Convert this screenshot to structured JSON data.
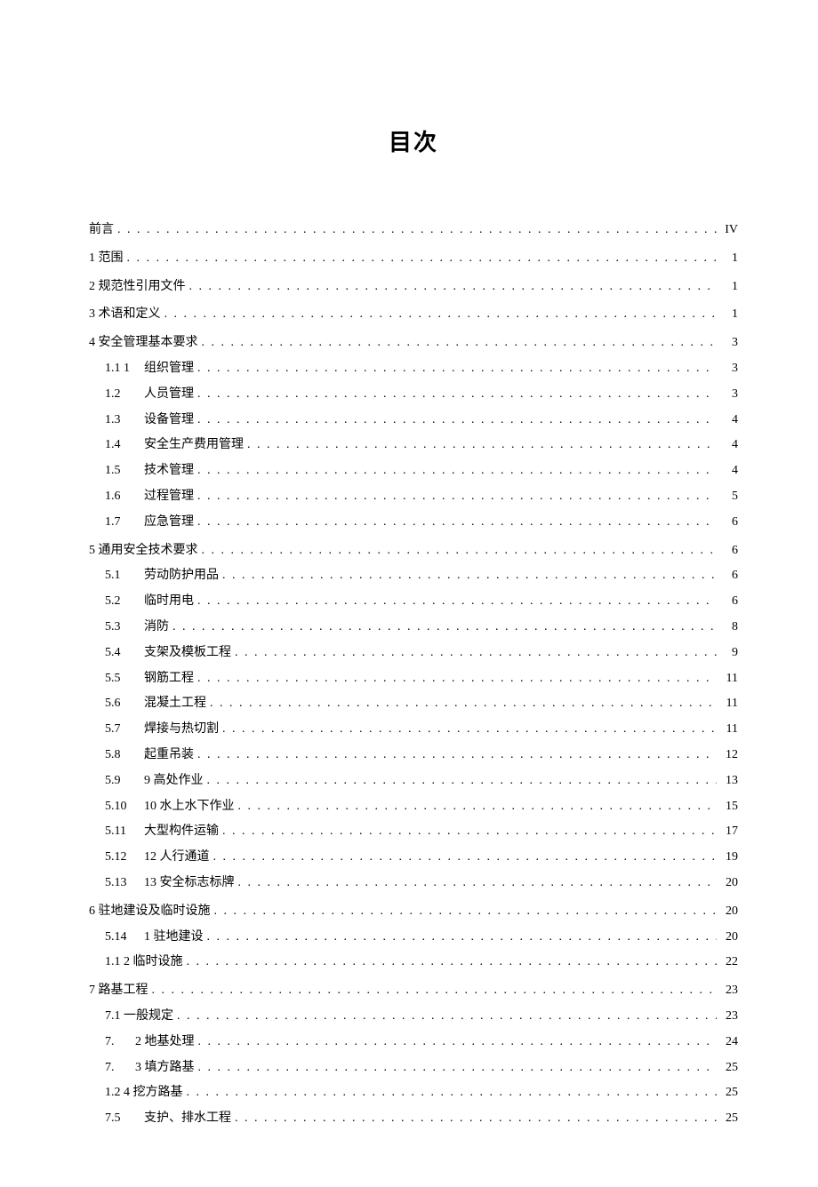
{
  "title": "目次",
  "entries": [
    {
      "level": 0,
      "num": "",
      "label": "前言",
      "page": "IV"
    },
    {
      "level": 0,
      "num": "",
      "label": "1 范围",
      "page": "1"
    },
    {
      "level": 0,
      "num": "",
      "label": "2 规范性引用文件",
      "page": "1"
    },
    {
      "level": 0,
      "num": "",
      "label": "3 术语和定义",
      "page": "1"
    },
    {
      "level": 0,
      "num": "",
      "label": "4 安全管理基本要求",
      "page": "3"
    },
    {
      "level": 1,
      "num": "1.1 1",
      "label": "组织管理",
      "page": "3"
    },
    {
      "level": 1,
      "num": "1.2",
      "label": "人员管理",
      "page": "3"
    },
    {
      "level": 1,
      "num": "1.3",
      "label": "设备管理",
      "page": "4"
    },
    {
      "level": 1,
      "num": "1.4",
      "label": "安全生产费用管理",
      "page": "4"
    },
    {
      "level": 1,
      "num": "1.5",
      "label": "技术管理",
      "page": "4"
    },
    {
      "level": 1,
      "num": "1.6",
      "label": "过程管理",
      "page": "5"
    },
    {
      "level": 1,
      "num": "1.7",
      "label": "应急管理",
      "page": "6"
    },
    {
      "level": 0,
      "num": "",
      "label": "5 通用安全技术要求",
      "page": "6"
    },
    {
      "level": 1,
      "num": "5.1",
      "label": "劳动防护用品",
      "page": "6"
    },
    {
      "level": 1,
      "num": "5.2",
      "label": "临时用电",
      "page": "6"
    },
    {
      "level": 1,
      "num": "5.3",
      "label": "消防",
      "page": "8"
    },
    {
      "level": 1,
      "num": "5.4",
      "label": "支架及模板工程",
      "page": "9"
    },
    {
      "level": 1,
      "num": "5.5",
      "label": "钢筋工程",
      "page": "11"
    },
    {
      "level": 1,
      "num": "5.6",
      "label": "混凝土工程",
      "page": "11"
    },
    {
      "level": 1,
      "num": "5.7",
      "label": "焊接与热切割",
      "page": "11"
    },
    {
      "level": 1,
      "num": "5.8",
      "label": "起重吊装",
      "page": "12"
    },
    {
      "level": 1,
      "num": "5.9",
      "label": "9 高处作业",
      "page": "13"
    },
    {
      "level": 1,
      "num": "5.10",
      "label": "10 水上水下作业",
      "page": "15"
    },
    {
      "level": 1,
      "num": "5.11",
      "label": " 大型构件运输",
      "page": "17"
    },
    {
      "level": 1,
      "num": "5.12",
      "label": "12 人行通道",
      "page": "19"
    },
    {
      "level": 1,
      "num": "5.13",
      "label": "13 安全标志标牌",
      "page": "20"
    },
    {
      "level": 0,
      "num": "",
      "label": "6 驻地建设及临时设施",
      "page": "20"
    },
    {
      "level": 1,
      "num": "5.14",
      "label": "1 驻地建设",
      "page": "20"
    },
    {
      "level": 1,
      "num": "",
      "label": "1.1 2 临时设施",
      "page": "22",
      "narrow": true
    },
    {
      "level": 0,
      "num": "",
      "label": "7 路基工程",
      "page": "23"
    },
    {
      "level": 1,
      "num": "",
      "label": "7.1 一般规定",
      "page": "23",
      "narrow": true
    },
    {
      "level": 1,
      "num": "7.",
      "label": "2 地基处理",
      "page": "24",
      "narrow": true,
      "gap": true
    },
    {
      "level": 1,
      "num": "7.",
      "label": "3 填方路基",
      "page": "25",
      "narrow": true,
      "gap": true
    },
    {
      "level": 1,
      "num": "",
      "label": "1.2 4 挖方路基",
      "page": "25",
      "narrow": true
    },
    {
      "level": 1,
      "num": "7.5",
      "label": "支护、排水工程",
      "page": "25"
    }
  ]
}
